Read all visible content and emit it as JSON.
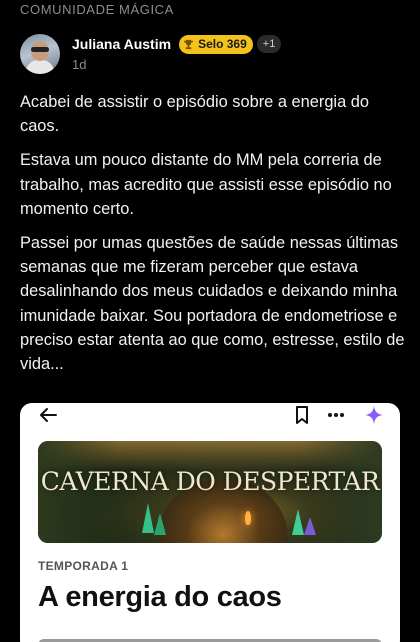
{
  "community": {
    "label": "COMUNIDADE MÁGICA"
  },
  "post": {
    "author": "Juliana Austim",
    "badge_label": "Selo 369",
    "extra_badges": "+1",
    "time": "1d",
    "paragraphs": [
      "Acabei de assistir o episódio sobre a energia do caos.",
      "Estava um pouco distante do MM pela correria de trabalho, mas acredito que assisti esse episódio no momento certo.",
      "Passei por umas questões de saúde nessas últimas semanas que me fizeram perceber que estava desalinhando dos meus cuidados e deixando minha imunidade baixar. Sou portadora de endometriose e preciso estar atenta ao que como, estresse, estilo de vida..."
    ]
  },
  "embedded_card": {
    "toolbar_icons": [
      "back-arrow-icon",
      "bookmark-icon",
      "more-options-icon",
      "sparkle-icon"
    ],
    "banner_title": "CAVERNA DO DESPERTAR",
    "season_label": "TEMPORADA 1",
    "episode_title": "A energia do caos"
  },
  "colors": {
    "badge": "#f3c21b",
    "sparkle": "#8b5cf6",
    "background": "#000000"
  }
}
